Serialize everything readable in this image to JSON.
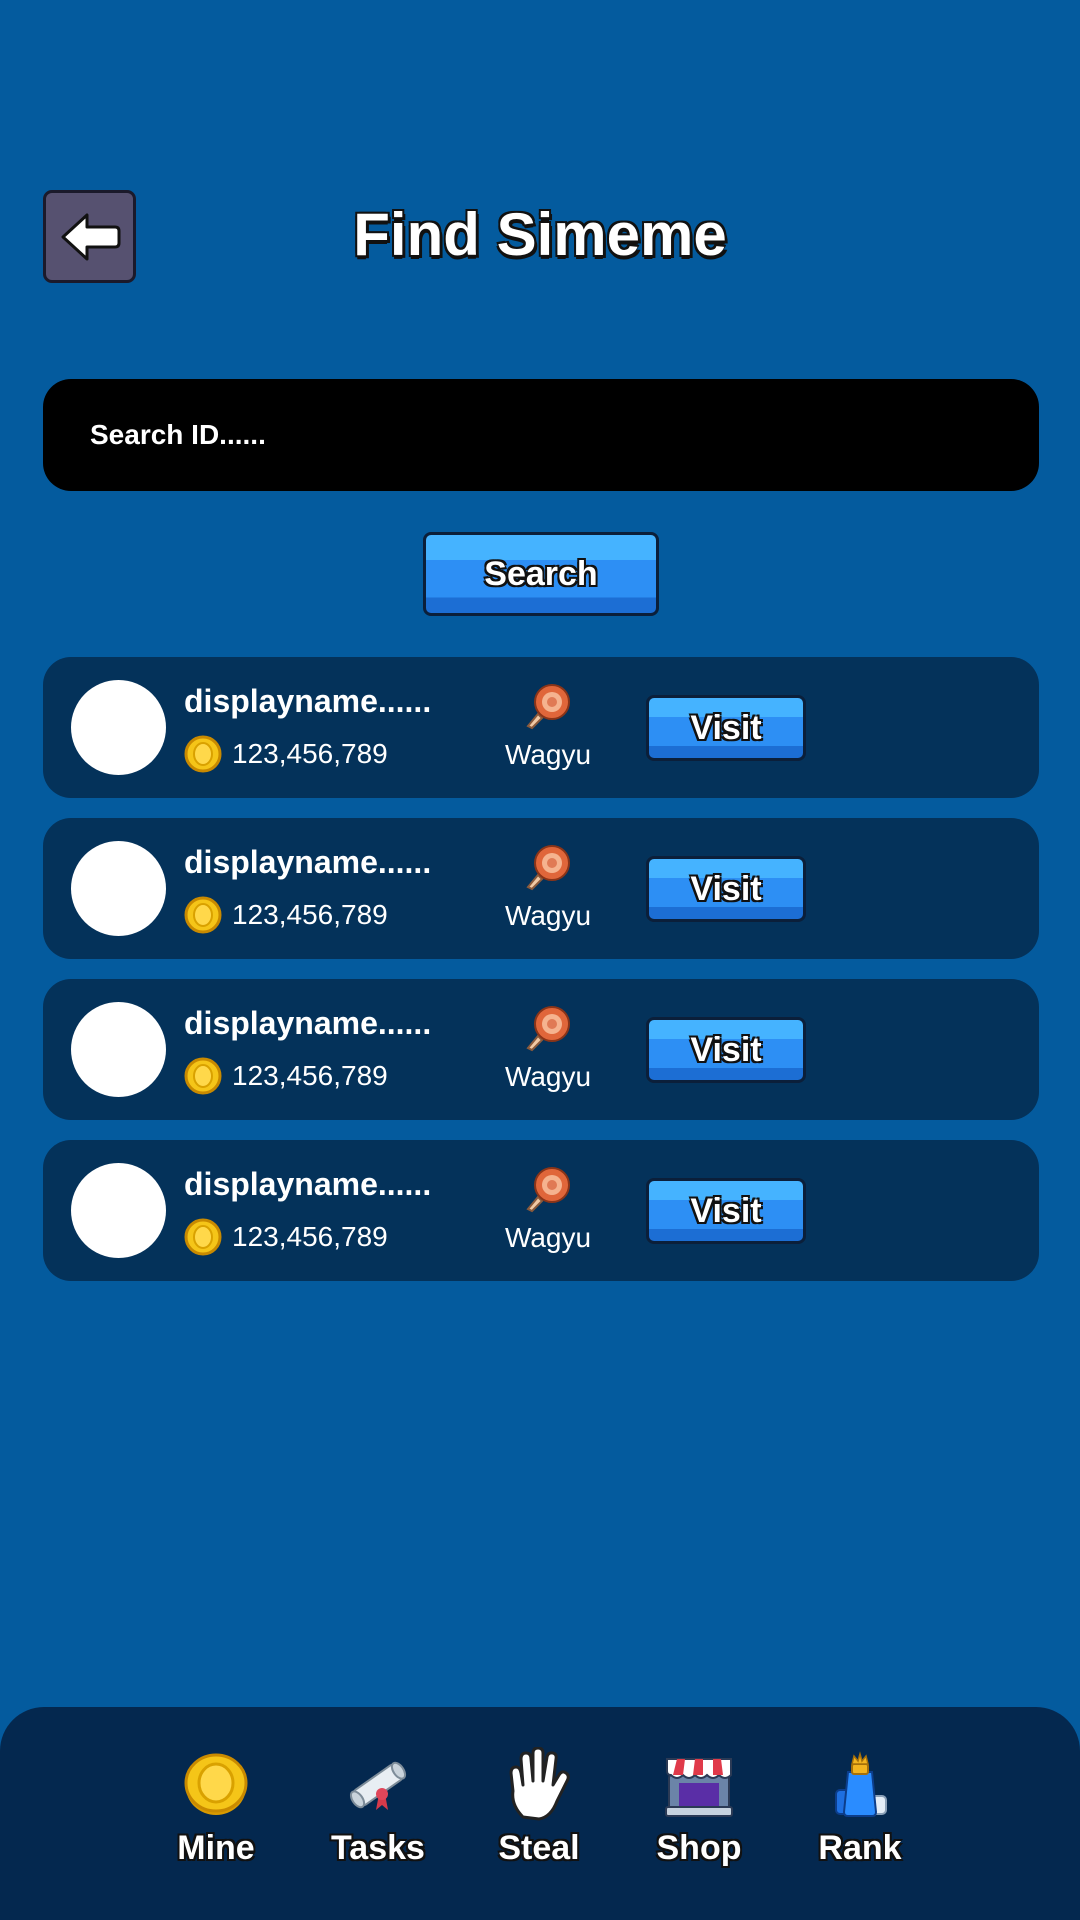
{
  "header": {
    "title": "Find Simeme",
    "back_icon": "arrow-left-icon"
  },
  "search": {
    "placeholder": "Search ID......",
    "value": "",
    "button_label": "Search"
  },
  "results": [
    {
      "display_name": "displayname......",
      "coins": "123,456,789",
      "food": "Wagyu",
      "visit_label": "Visit"
    },
    {
      "display_name": "displayname......",
      "coins": "123,456,789",
      "food": "Wagyu",
      "visit_label": "Visit"
    },
    {
      "display_name": "displayname......",
      "coins": "123,456,789",
      "food": "Wagyu",
      "visit_label": "Visit"
    },
    {
      "display_name": "displayname......",
      "coins": "123,456,789",
      "food": "Wagyu",
      "visit_label": "Visit"
    }
  ],
  "bottom_nav": {
    "items": [
      {
        "label": "Mine",
        "icon": "coin-icon"
      },
      {
        "label": "Tasks",
        "icon": "scroll-icon"
      },
      {
        "label": "Steal",
        "icon": "glove-hand-icon"
      },
      {
        "label": "Shop",
        "icon": "store-icon"
      },
      {
        "label": "Rank",
        "icon": "trophy-bottle-icon"
      }
    ]
  },
  "colors": {
    "background": "#045b9e",
    "card": "#04325a",
    "nav_bar": "#04284f",
    "button_blue": "#2d8ff4",
    "back_button": "#565170",
    "coin": "#f5c518"
  }
}
